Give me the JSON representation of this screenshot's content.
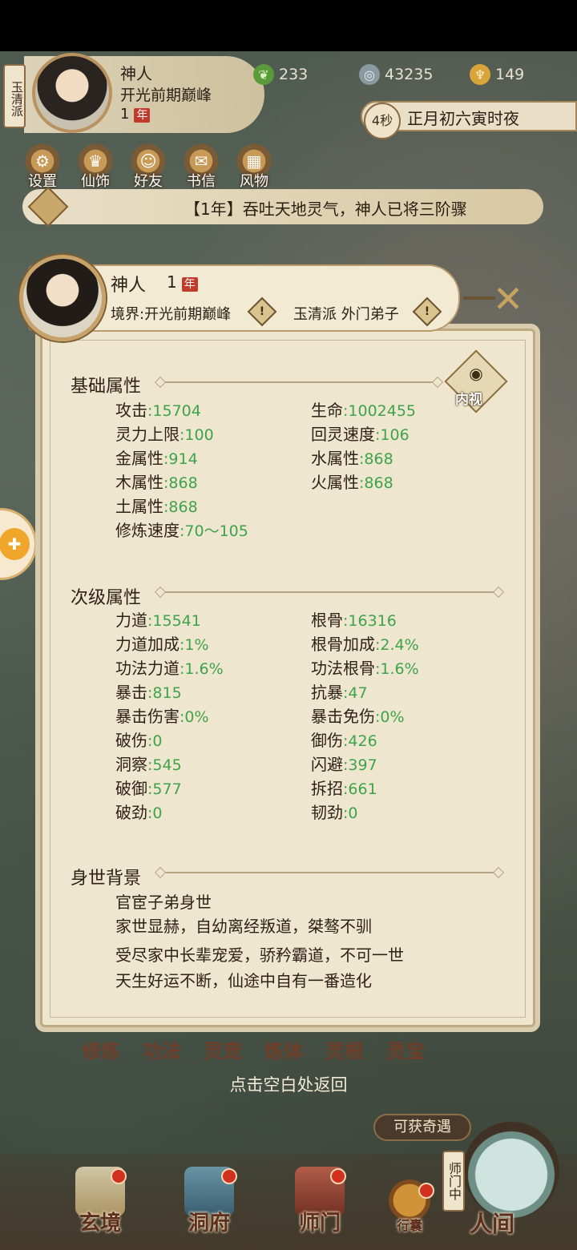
{
  "hud": {
    "sect": "玉清派",
    "name": "神人",
    "realm": "开光前期巅峰",
    "year_num": "1",
    "year_badge": "年",
    "resources": [
      {
        "icon": "jade-leaf-icon",
        "value": "233"
      },
      {
        "icon": "coin-icon",
        "value": "43235"
      },
      {
        "icon": "ingot-icon",
        "value": "149"
      }
    ],
    "timer": "4秒",
    "time_of_day": "正月初六寅时夜"
  },
  "quick_menu": [
    "设置",
    "仙饰",
    "好友",
    "书信",
    "风物"
  ],
  "news": "【1年】吞吐天地灵气，神人已将三阶骤",
  "dialog": {
    "name": "神人",
    "year_num": "1",
    "year_badge": "年",
    "realm": "境界:开光前期巅峰",
    "sect": "玉清派 外门弟子",
    "warn_mark": "!",
    "close_mark": "✕",
    "inner_view": "内视",
    "basic_title": "基础属性",
    "basic_stats": [
      {
        "label": "攻击",
        "value": ":15704"
      },
      {
        "label": "生命",
        "value": ":1002455"
      },
      {
        "label": "灵力上限",
        "value": ":100"
      },
      {
        "label": "回灵速度",
        "value": ":106"
      },
      {
        "label": "金属性",
        "value": ":914"
      },
      {
        "label": "水属性",
        "value": ":868"
      },
      {
        "label": "木属性",
        "value": ":868"
      },
      {
        "label": "火属性",
        "value": ":868"
      },
      {
        "label": "土属性",
        "value": ":868"
      },
      {
        "label": "修炼速度",
        "value": ":70～105"
      }
    ],
    "secondary_title": "次级属性",
    "secondary_stats": [
      {
        "label": "力道",
        "value": ":15541"
      },
      {
        "label": "根骨",
        "value": ":16316"
      },
      {
        "label": "力道加成",
        "value": ":1%"
      },
      {
        "label": "根骨加成",
        "value": ":2.4%"
      },
      {
        "label": "功法力道",
        "value": ":1.6%"
      },
      {
        "label": "功法根骨",
        "value": ":1.6%"
      },
      {
        "label": "暴击",
        "value": ":815"
      },
      {
        "label": "抗暴",
        "value": ":47"
      },
      {
        "label": "暴击伤害",
        "value": ":0%"
      },
      {
        "label": "暴击免伤",
        "value": ":0%"
      },
      {
        "label": "破伤",
        "value": ":0"
      },
      {
        "label": "御伤",
        "value": ":426"
      },
      {
        "label": "洞察",
        "value": ":545"
      },
      {
        "label": "闪避",
        "value": ":397"
      },
      {
        "label": "破御",
        "value": ":577"
      },
      {
        "label": "拆招",
        "value": ":661"
      },
      {
        "label": "破劲",
        "value": ":0"
      },
      {
        "label": "韧劲",
        "value": ":0"
      }
    ],
    "background_title": "身世背景",
    "background_lines": [
      "官宦子弟身世",
      "家世显赫，自幼离经叛道，桀骜不驯",
      "受尽家中长辈宠爱，骄矜霸道，不可一世",
      "天生好运不断，仙途中自有一番造化"
    ]
  },
  "behind_tabs": [
    "修炼",
    "功法",
    "灵宠",
    "炼体",
    "灵根",
    "灵宝"
  ],
  "return_hint": "点击空白处返回",
  "chance_button": "可获奇遇",
  "bottom_nav": [
    "玄境",
    "洞府",
    "师门",
    "行囊"
  ],
  "shimen_tag": "师门中",
  "renjian_label": "人间",
  "colors": {
    "stat_value": "#3ea34a",
    "badge_red": "#c23a2a"
  }
}
